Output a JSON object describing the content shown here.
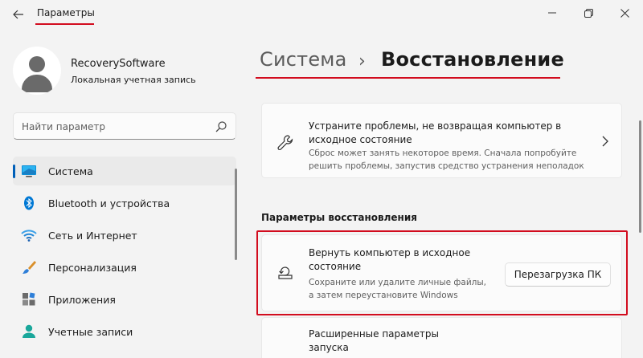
{
  "window": {
    "title": "Параметры",
    "controls": [
      "minimize-icon",
      "restore-icon",
      "close-icon"
    ]
  },
  "profile": {
    "name": "RecoverySoftware",
    "account_type": "Локальная учетная запись"
  },
  "search": {
    "placeholder": "Найти параметр"
  },
  "sidebar": {
    "items": [
      {
        "label": "Система",
        "icon": "system-icon",
        "active": true
      },
      {
        "label": "Bluetooth и устройства",
        "icon": "bluetooth-icon",
        "active": false
      },
      {
        "label": "Сеть и Интернет",
        "icon": "wifi-icon",
        "active": false
      },
      {
        "label": "Персонализация",
        "icon": "brush-icon",
        "active": false
      },
      {
        "label": "Приложения",
        "icon": "apps-icon",
        "active": false
      },
      {
        "label": "Учетные записи",
        "icon": "account-icon",
        "active": false
      }
    ]
  },
  "header": {
    "parent": "Система",
    "separator": "›",
    "current": "Восстановление"
  },
  "troubleshoot_card": {
    "title": "Устраните проблемы, не возвращая компьютер в исходное состояние",
    "description": "Сброс может занять некоторое время. Сначала попробуйте решить проблемы, запустив средство устранения неполадок",
    "icon": "wrench-icon"
  },
  "recovery_section": {
    "title": "Параметры восстановления",
    "reset": {
      "title": "Вернуть компьютер в исходное состояние",
      "description": "Сохраните или удалите личные файлы, а затем переустановите Windows",
      "button_label": "Перезагрузка ПК",
      "icon": "reset-pc-icon"
    },
    "advanced": {
      "title": "Расширенные параметры запуска"
    }
  },
  "colors": {
    "accent": "#005fb8",
    "highlight_red": "#d20c1e",
    "background": "#f3f3f3",
    "card": "#fbfbfb"
  }
}
